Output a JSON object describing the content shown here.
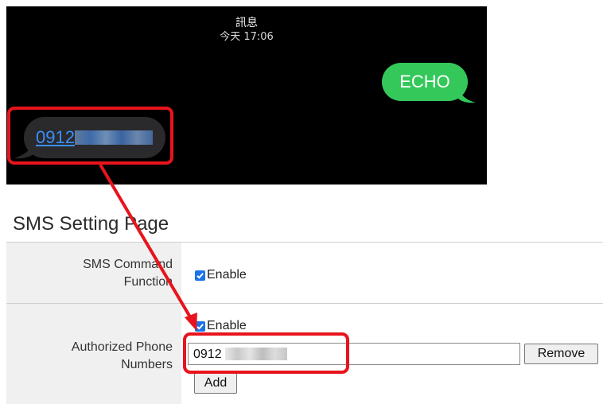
{
  "messages": {
    "title": "訊息",
    "time": "今天 17:06",
    "outgoing": "ECHO",
    "incoming_number": "0912"
  },
  "sms_page": {
    "title": "SMS Setting Page",
    "command_label": "SMS Command Function",
    "command_enable_label": "Enable",
    "command_enabled": true,
    "phones_label": "Authorized Phone Numbers",
    "phones_enable_label": "Enable",
    "phones_enabled": true,
    "phone_value": "0912",
    "remove_label": "Remove",
    "add_label": "Add"
  },
  "colors": {
    "highlight": "#e8141c",
    "outgoing_bubble": "#34c85a",
    "incoming_bubble": "#2a2a2c",
    "link": "#3a8fff"
  }
}
